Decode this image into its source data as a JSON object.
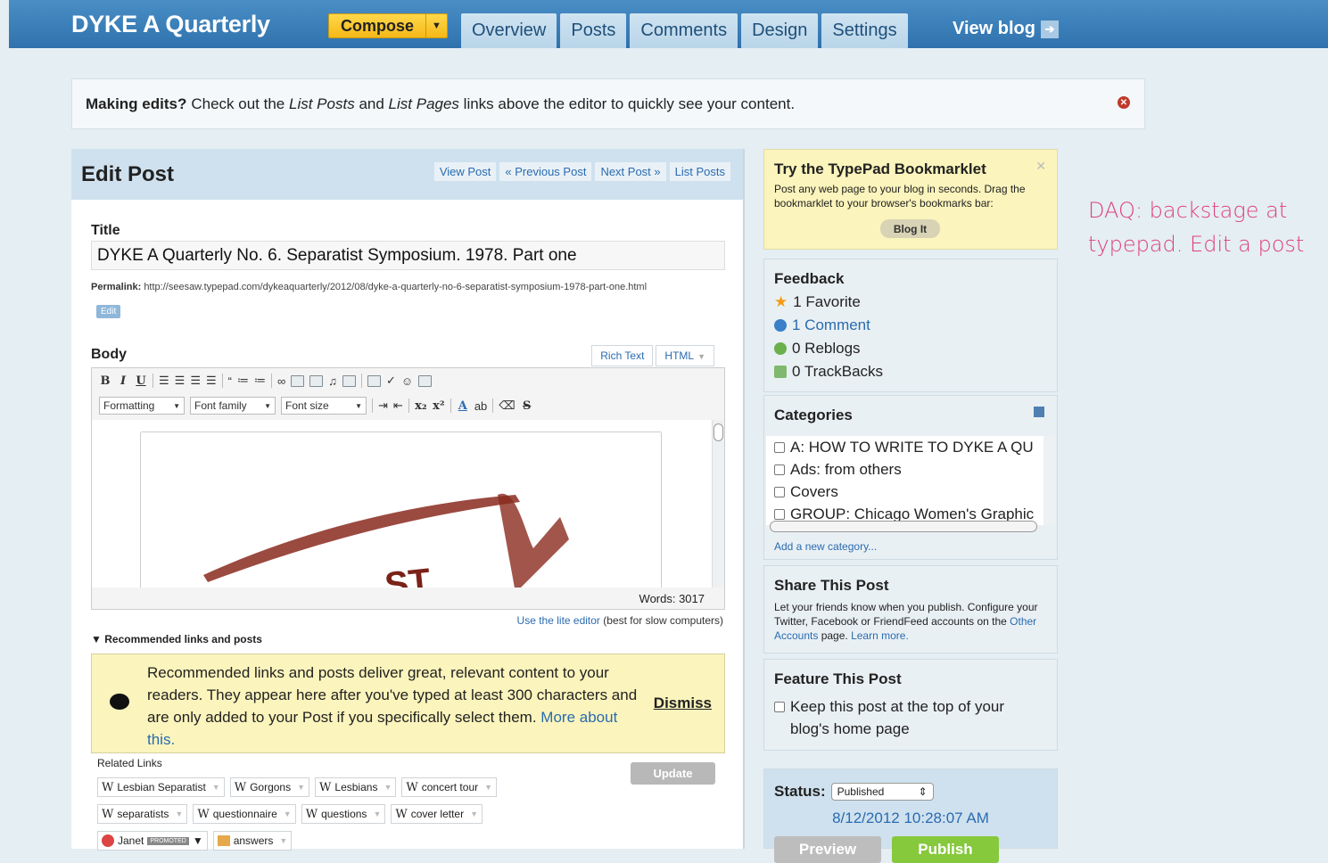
{
  "header": {
    "blog_title": "DYKE A Quarterly",
    "compose_label": "Compose",
    "tabs": [
      "Overview",
      "Posts",
      "Comments",
      "Design",
      "Settings"
    ],
    "view_blog": "View blog"
  },
  "notice": {
    "bold": "Making edits?",
    "pre": "Check out the",
    "em1": "List Posts",
    "mid": "and",
    "em2": "List Pages",
    "post": "links above the editor to quickly see your content."
  },
  "edit": {
    "heading": "Edit Post",
    "links": [
      "View Post",
      "« Previous Post",
      "Next Post »",
      "List Posts"
    ],
    "title_label": "Title",
    "title_value": "DYKE A Quarterly No. 6. Separatist Symposium. 1978. Part one",
    "permalink_label": "Permalink:",
    "permalink_url": "http://seesaw.typepad.com/dykeaquarterly/2012/08/dyke-a-quarterly-no-6-separatist-symposium-1978-part-one.html",
    "edit_chip": "Edit",
    "body_label": "Body",
    "mode_rich": "Rich Text",
    "mode_html": "HTML",
    "formatting": "Formatting",
    "font_family": "Font family",
    "font_size": "Font size",
    "words": "Words: 3017",
    "lite_link": "Use the lite editor",
    "lite_suffix": "(best for slow computers)",
    "rec_toggle": "Recommended links and posts",
    "rec_text": "Recommended links and posts deliver great, relevant content to your readers. They appear here after you've typed at least 300 characters and are only added to your Post if you specifically select them.",
    "rec_more": "More about this.",
    "rec_dismiss": "Dismiss",
    "related_label": "Related Links",
    "update": "Update",
    "chips": [
      "Lesbian Separatist",
      "Gorgons",
      "Lesbians",
      "concert tour",
      "separatists",
      "questionnaire",
      "questions",
      "cover letter"
    ],
    "promoted_chip": "Janet",
    "promoted_tag": "PROMOTED",
    "answers_chip": "answers"
  },
  "sidebar": {
    "bookmarklet_title": "Try the TypePad Bookmarklet",
    "bookmarklet_text": "Post any web page to your blog in seconds. Drag the bookmarklet to your browser's bookmarks bar:",
    "blogit": "Blog It",
    "feedback_title": "Feedback",
    "feedback": [
      "1 Favorite",
      "1 Comment",
      "0 Reblogs",
      "0 TrackBacks"
    ],
    "categories_title": "Categories",
    "categories": [
      "A: HOW TO WRITE TO DYKE A QU",
      "Ads: from others",
      "Covers",
      "GROUP: Chicago Women's Graphic"
    ],
    "add_category": "Add a new category...",
    "share_title": "Share This Post",
    "share_text": "Let your friends know when you publish. Configure your Twitter, Facebook or FriendFeed accounts on the",
    "share_link": "Other Accounts",
    "share_suffix": "page.",
    "share_learn": "Learn more.",
    "feature_title": "Feature This Post",
    "feature_text": "Keep this post at the top of your blog's home page",
    "status_label": "Status:",
    "status_value": "Published",
    "status_date": "8/12/2012 10:28:07 AM",
    "preview": "Preview",
    "publish": "Publish"
  },
  "annotation": {
    "line1": "DAQ: backstage at",
    "line2": "typepad. Edit a post"
  }
}
